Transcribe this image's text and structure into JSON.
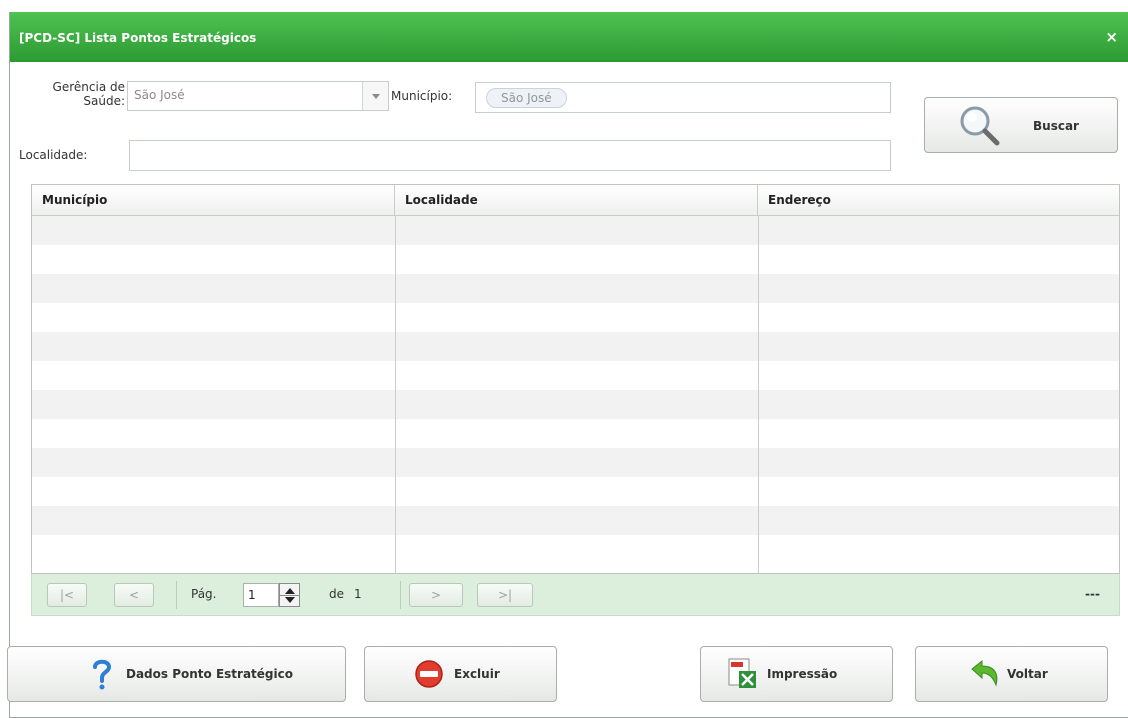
{
  "window": {
    "title": "[PCD-SC] Lista Pontos Estratégicos",
    "close_label": "×"
  },
  "form": {
    "gerencia_label_line1": "Gerência de",
    "gerencia_label_line2": "Saúde:",
    "gerencia_value": "São José",
    "municipio_label": "Município:",
    "municipio_value": "São José",
    "localidade_label": "Localidade:",
    "localidade_value": "",
    "buscar_label": "Buscar"
  },
  "table": {
    "columns": [
      "Município",
      "Localidade",
      "Endereço"
    ],
    "rows": []
  },
  "pager": {
    "first": "|<",
    "prev": "<",
    "page_label": "Pág.",
    "page_value": "1",
    "of_label": "de",
    "total_pages": "1",
    "next": ">",
    "last": ">|",
    "status": "---"
  },
  "actions": {
    "dados_label": "Dados Ponto Estratégico",
    "excluir_label": "Excluir",
    "impressao_label": "Impressão",
    "voltar_label": "Voltar"
  },
  "icons": {
    "dados": "question-icon",
    "excluir": "no-entry-icon",
    "impressao": "pdf-excel-icon",
    "voltar": "back-arrow-icon",
    "buscar": "magnifier-icon"
  },
  "colors": {
    "titlebar": "#3aae3f",
    "pager_bg": "#dcefdc"
  }
}
